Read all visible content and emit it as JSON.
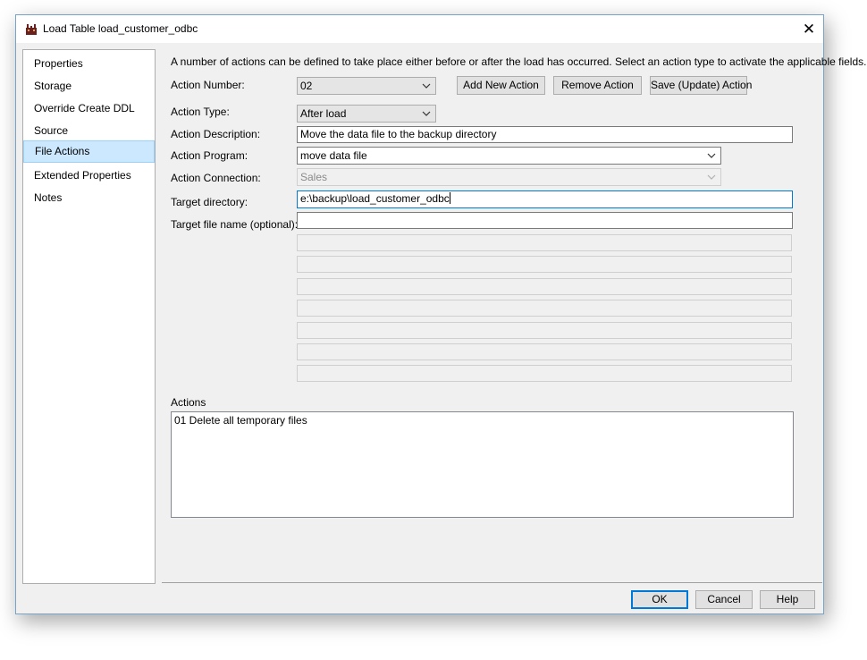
{
  "window": {
    "title": "Load Table load_customer_odbc",
    "close": "✕"
  },
  "nav": {
    "items": [
      "Properties",
      "Storage",
      "Override Create DDL",
      "Source",
      "File Actions",
      "Extended Properties",
      "Notes"
    ]
  },
  "intro": "A number of actions can be defined to take place either before or after the load has occurred. Select an action type to activate the applicable fields.",
  "form": {
    "action_number_label": "Action Number:",
    "action_number": "02",
    "action_type_label": "Action Type:",
    "action_type": "After load",
    "action_description_label": "Action Description:",
    "action_description": "Move the data file to the backup directory",
    "action_program_label": "Action Program:",
    "action_program": "move data file",
    "action_connection_label": "Action Connection:",
    "action_connection": "Sales",
    "target_directory_label": "Target directory:",
    "target_directory": "e:\\backup\\load_customer_odbc",
    "target_file_label": "Target file name (optional):",
    "target_file": ""
  },
  "buttons": {
    "add": "Add New Action",
    "remove": "Remove Action",
    "save": "Save (Update) Action",
    "ok": "OK",
    "cancel": "Cancel",
    "help": "Help"
  },
  "actions": {
    "label": "Actions",
    "items": [
      "01 Delete all temporary files"
    ]
  }
}
